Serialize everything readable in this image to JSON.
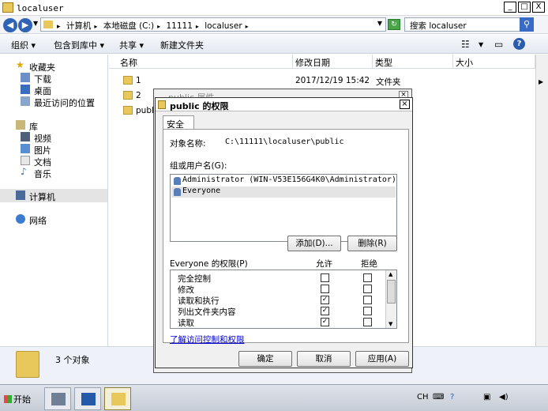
{
  "explorer": {
    "title": "localuser",
    "caption_buttons": [
      "_",
      "□",
      "X"
    ],
    "breadcrumbs": [
      "计算机",
      "本地磁盘 (C:)",
      "11111",
      "localuser"
    ],
    "search_placeholder": "搜索 localuser",
    "toolbar": {
      "organize": "组织",
      "include_in_library": "包含到库中",
      "share": "共享",
      "new_folder": "新建文件夹"
    },
    "nav": {
      "favorites": "收藏夹",
      "downloads": "下载",
      "desktop": "桌面",
      "recent": "最近访问的位置",
      "libraries": "库",
      "videos": "视频",
      "pictures": "图片",
      "documents": "文档",
      "music": "音乐",
      "computer": "计算机",
      "network": "网络"
    },
    "columns": {
      "name": "名称",
      "modified": "修改日期",
      "type": "类型",
      "size": "大小"
    },
    "files": [
      {
        "name": "1",
        "date": "2017/12/19 15:42",
        "type": "文件夹"
      },
      {
        "name": "2",
        "date": "",
        "type": ""
      },
      {
        "name": "publ",
        "date": "",
        "type": ""
      }
    ],
    "details": {
      "count": "3 个对象"
    }
  },
  "taskbar": {
    "start": "开始",
    "tray": {
      "ime": "CH"
    }
  },
  "background_dialog": {
    "title": "public 属性"
  },
  "dialog": {
    "title": "public 的权限",
    "tab": "安全",
    "object_label": "对象名称:",
    "object_path": "C:\\11111\\localuser\\public",
    "group_label": "组或用户名(G):",
    "users": [
      "Administrator (WIN-V53E156G4K0\\Administrator)",
      "Everyone"
    ],
    "add_button": "添加(D)...",
    "remove_button": "删除(R)",
    "perm_label": "Everyone 的权限(P)",
    "allow_header": "允许",
    "deny_header": "拒绝",
    "permissions": [
      {
        "name": "完全控制",
        "allow": false,
        "deny": false
      },
      {
        "name": "修改",
        "allow": false,
        "deny": false
      },
      {
        "name": "读取和执行",
        "allow": true,
        "deny": false
      },
      {
        "name": "列出文件夹内容",
        "allow": true,
        "deny": false
      },
      {
        "name": "读取",
        "allow": true,
        "deny": false
      }
    ],
    "learn_link": "了解访问控制和权限",
    "ok_button": "确定",
    "cancel_button": "取消",
    "apply_button": "应用(A)"
  }
}
